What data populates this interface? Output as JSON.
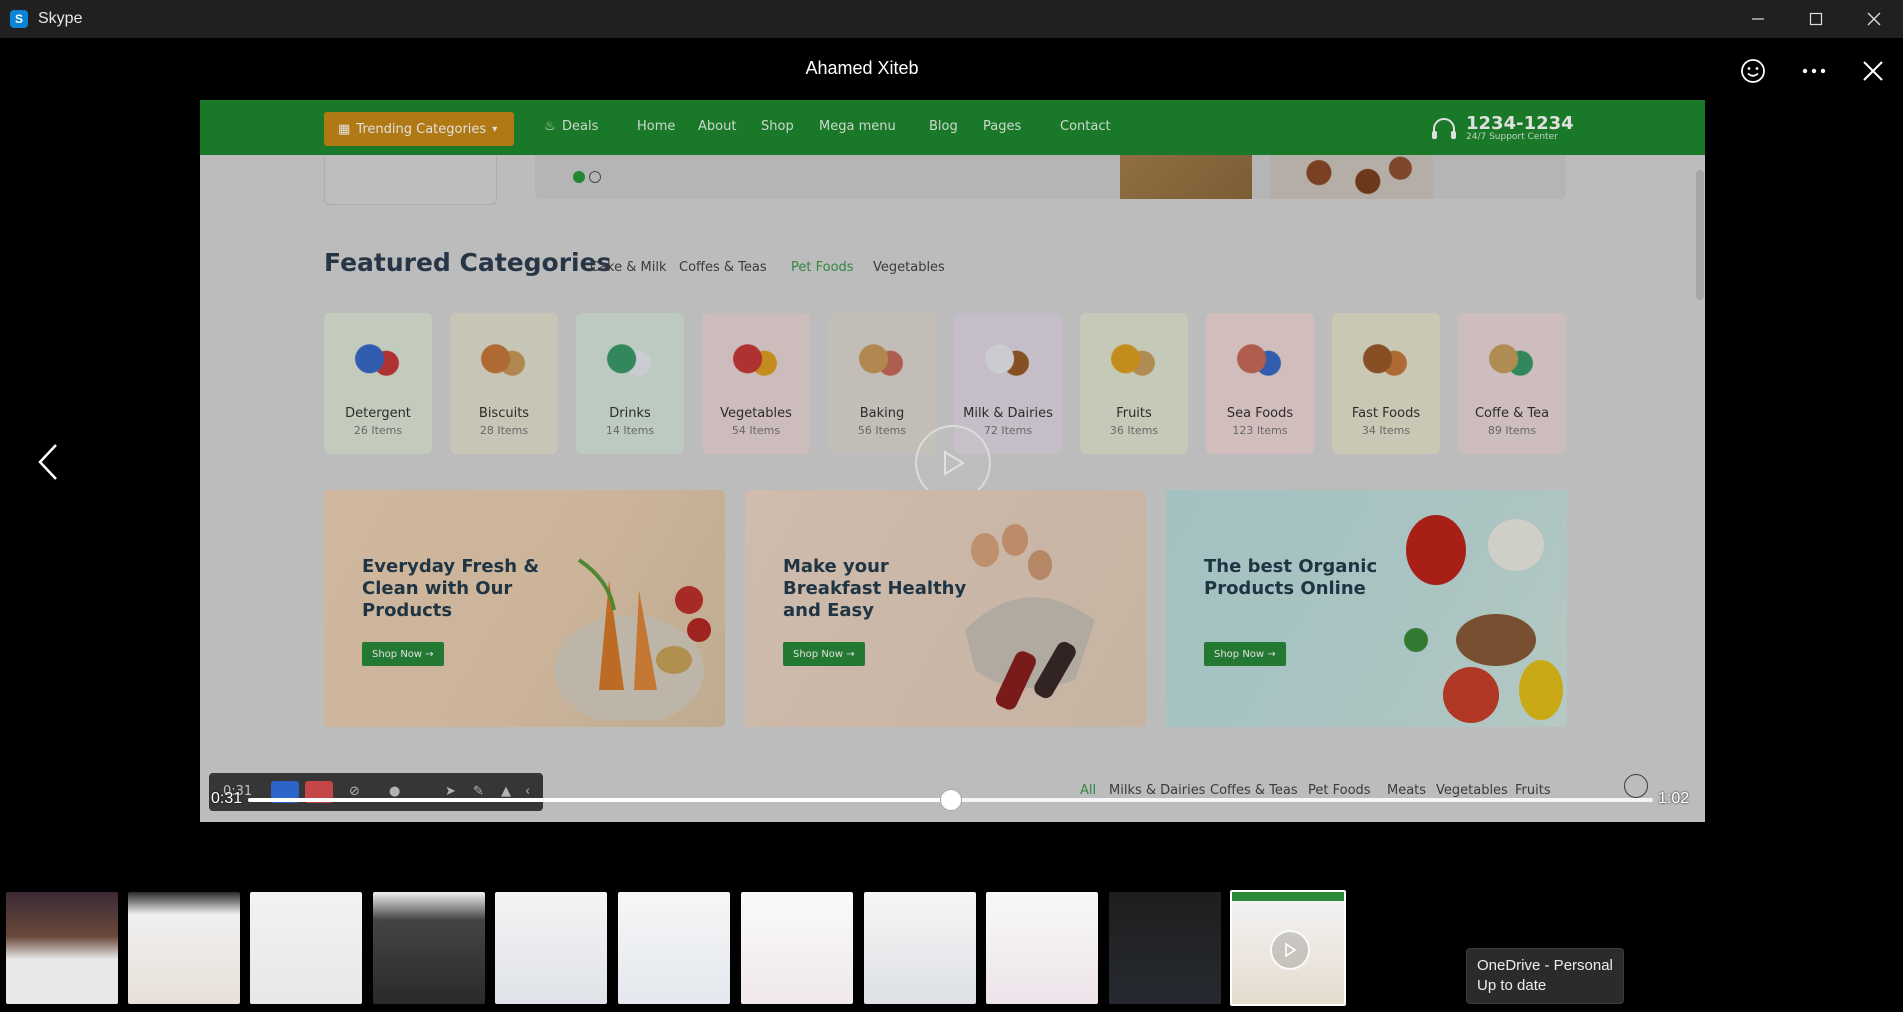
{
  "window": {
    "app_title": "Skype",
    "app_logo_letter": "S"
  },
  "viewer": {
    "sender_name": "Ahamed Xiteb"
  },
  "video": {
    "current_time": "0:31",
    "total_time": "1:02",
    "progress": 0.5
  },
  "site": {
    "trending_label": "Trending Categories",
    "nav_links": [
      "Deals",
      "Home",
      "About",
      "Shop",
      "Mega menu",
      "Blog",
      "Pages",
      "Contact"
    ],
    "phone_number": "1234-1234",
    "phone_sub": "24/7 Support Center",
    "featured_title": "Featured Categories",
    "featured_tabs": [
      "Cake & Milk",
      "Coffes & Teas",
      "Pet Foods",
      "Vegetables"
    ],
    "categories": [
      {
        "name": "Detergent",
        "count": "26 Items",
        "bg": "#dfe8d8"
      },
      {
        "name": "Biscuits",
        "count": "28 Items",
        "bg": "#e3e1cf"
      },
      {
        "name": "Drinks",
        "count": "14 Items",
        "bg": "#d8e6dc"
      },
      {
        "name": "Vegetables",
        "count": "54 Items",
        "bg": "#e9d6d6"
      },
      {
        "name": "Baking",
        "count": "56 Items",
        "bg": "#ddd8d0"
      },
      {
        "name": "Milk & Dairies",
        "count": "72 Items",
        "bg": "#e1d8e3"
      },
      {
        "name": "Fruits",
        "count": "36 Items",
        "bg": "#e1e6d2"
      },
      {
        "name": "Sea Foods",
        "count": "123 Items",
        "bg": "#eed8d6"
      },
      {
        "name": "Fast Foods",
        "count": "34 Items",
        "bg": "#e7e3cf"
      },
      {
        "name": "Coffe & Tea",
        "count": "89 Items",
        "bg": "#ead8d8"
      }
    ],
    "banners": [
      {
        "title": "Everyday Fresh & Clean with Our Products",
        "button": "Shop Now →"
      },
      {
        "title": "Make your Breakfast Healthy and Easy",
        "button": "Shop Now →"
      },
      {
        "title": "The best Organic Products Online",
        "button": "Shop Now →"
      }
    ],
    "product_tabs": [
      "All",
      "Milks & Dairies",
      "Coffes & Teas",
      "Pet Foods",
      "Meats",
      "Vegetables",
      "Fruits"
    ]
  },
  "recorder": {
    "time": "0:31"
  },
  "tooltip": {
    "line1": "OneDrive - Personal",
    "line2": "Up to date"
  },
  "colors": {
    "site_green": "#1e8a2e",
    "accent_orange": "#c98a16",
    "skype_blue": "#0a84d6"
  }
}
